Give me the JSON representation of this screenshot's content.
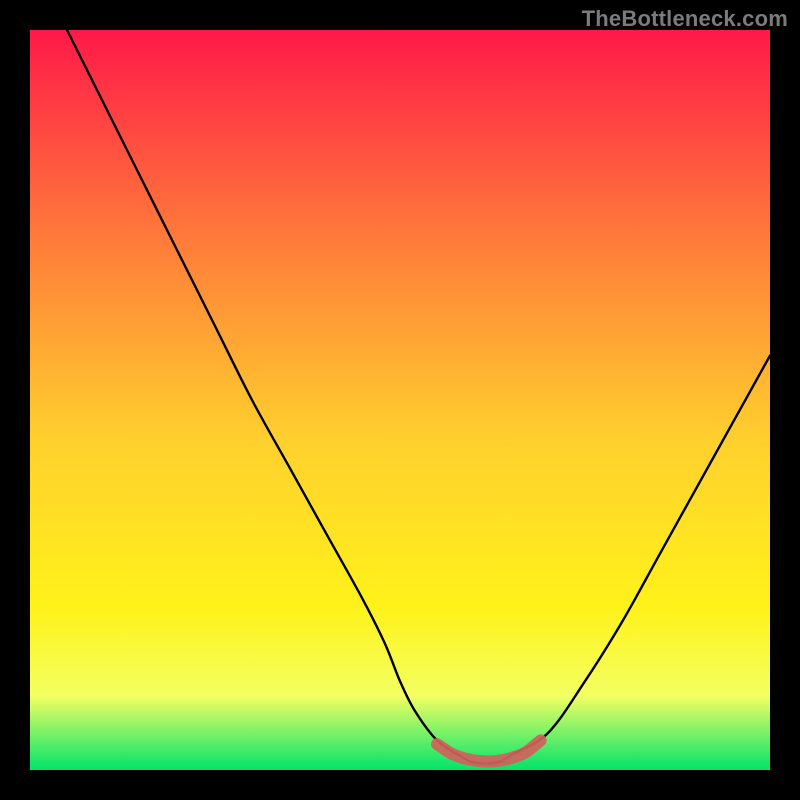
{
  "watermark": "TheBottleneck.com",
  "gradient": {
    "top": "#ff1948",
    "q1": "#ff7a3a",
    "mid": "#ffcf2e",
    "q3": "#fff21a",
    "band_top": "#f3ff63",
    "band_bot": "#00e46b"
  },
  "curve_color": "#000000",
  "marker_color": "#d1615c",
  "chart_data": {
    "type": "line",
    "title": "",
    "xlabel": "",
    "ylabel": "",
    "xlim": [
      0,
      100
    ],
    "ylim": [
      0,
      100
    ],
    "series": [
      {
        "name": "curve",
        "x": [
          5,
          10,
          15,
          20,
          25,
          30,
          35,
          40,
          45,
          48,
          50,
          52,
          55,
          58,
          60,
          63,
          65,
          70,
          75,
          80,
          85,
          90,
          95,
          100
        ],
        "y": [
          100,
          90,
          80,
          70,
          60,
          50,
          41,
          32,
          23,
          17,
          12,
          8,
          4,
          2,
          1,
          1,
          2,
          5,
          12,
          20,
          29,
          38,
          47,
          56
        ]
      },
      {
        "name": "highlight",
        "x": [
          55,
          57,
          59,
          61,
          63,
          65,
          67,
          69
        ],
        "y": [
          3.5,
          2.2,
          1.5,
          1.2,
          1.2,
          1.6,
          2.4,
          4.0
        ]
      }
    ],
    "green_band_y": [
      0,
      8
    ],
    "annotations": []
  }
}
